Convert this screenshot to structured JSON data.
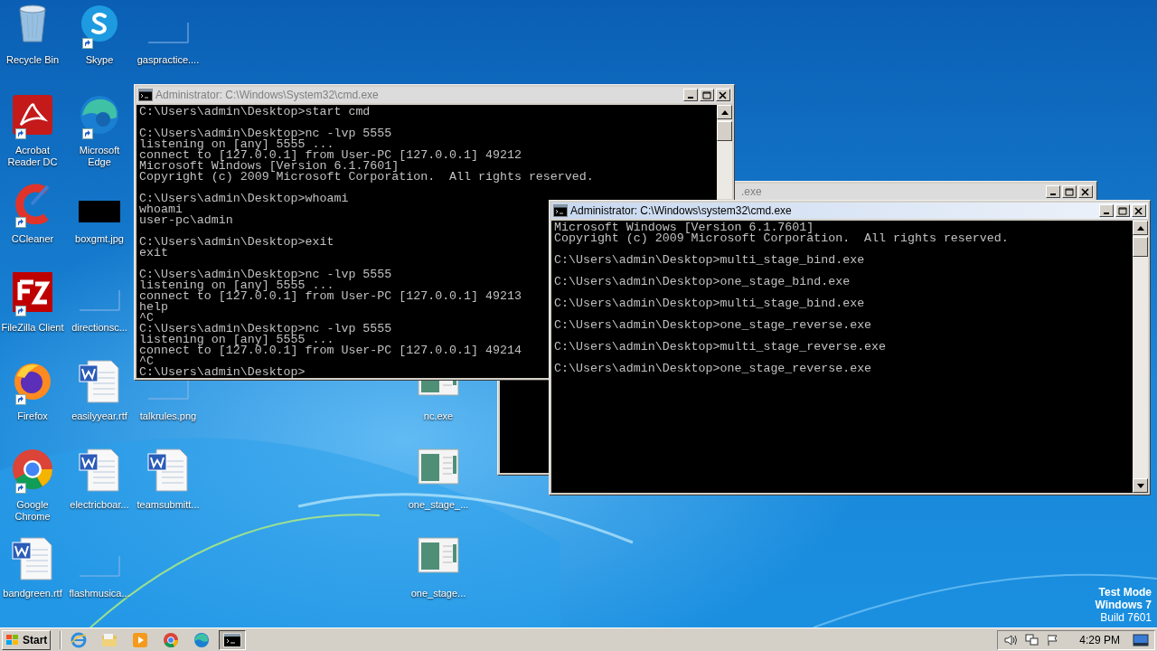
{
  "desktop_icons": [
    {
      "label": "Recycle Bin",
      "kind": "recycle",
      "shortcut": false
    },
    {
      "label": "Acrobat Reader DC",
      "kind": "acrobat",
      "shortcut": true
    },
    {
      "label": "CCleaner",
      "kind": "ccleaner",
      "shortcut": true
    },
    {
      "label": "FileZilla Client",
      "kind": "filezilla",
      "shortcut": true
    },
    {
      "label": "Firefox",
      "kind": "firefox",
      "shortcut": true
    },
    {
      "label": "Google Chrome",
      "kind": "chrome",
      "shortcut": true
    },
    {
      "label": "bandgreen.rtf",
      "kind": "word",
      "shortcut": false
    },
    {
      "label": "Skype",
      "kind": "skype",
      "shortcut": true
    },
    {
      "label": "Microsoft Edge",
      "kind": "edge",
      "shortcut": true
    },
    {
      "label": "boxgmt.jpg",
      "kind": "dark-image",
      "shortcut": false
    },
    {
      "label": "directionsc...",
      "kind": "blank",
      "shortcut": false
    },
    {
      "label": "easilyyear.rtf",
      "kind": "word",
      "shortcut": false
    },
    {
      "label": "electricboar...",
      "kind": "word",
      "shortcut": false
    },
    {
      "label": "flashmusica...",
      "kind": "blank",
      "shortcut": false
    },
    {
      "label": "gaspractice....",
      "kind": "blank",
      "shortcut": false
    },
    {
      "label": "talkrules.png",
      "kind": "blank",
      "shortcut": false
    },
    {
      "label": "teamsubmitt...",
      "kind": "word",
      "shortcut": false
    },
    {
      "label": "nc.exe",
      "kind": "exe",
      "shortcut": false
    },
    {
      "label": "one_stage_...",
      "kind": "exe",
      "shortcut": false
    },
    {
      "label": "one_stage...",
      "kind": "exe",
      "shortcut": false
    }
  ],
  "windows": [
    {
      "title": ".exe",
      "active": false
    },
    {
      "title": "Administrator: C:\\Windows\\System32\\cmd.exe",
      "active": false,
      "blocks": [
        [
          "C:\\Users\\admin\\Desktop>start cmd"
        ],
        [
          "C:\\Users\\admin\\Desktop>nc -lvp 5555",
          "listening on [any] 5555 ...",
          "connect to [127.0.0.1] from User-PC [127.0.0.1] 49212",
          "Microsoft Windows [Version 6.1.7601]",
          "Copyright (c) 2009 Microsoft Corporation.  All rights reserved."
        ],
        [
          "C:\\Users\\admin\\Desktop>whoami",
          "whoami",
          "user-pc\\admin"
        ],
        [
          "C:\\Users\\admin\\Desktop>exit",
          "exit"
        ],
        [
          "C:\\Users\\admin\\Desktop>nc -lvp 5555",
          "listening on [any] 5555 ...",
          "connect to [127.0.0.1] from User-PC [127.0.0.1] 49213",
          "help",
          "^C",
          "C:\\Users\\admin\\Desktop>nc -lvp 5555",
          "listening on [any] 5555 ...",
          "connect to [127.0.0.1] from User-PC [127.0.0.1] 49214",
          "^C",
          "C:\\Users\\admin\\Desktop>"
        ]
      ]
    },
    {
      "title": "Administrator: C:\\Windows\\system32\\cmd.exe",
      "active": true,
      "blocks": [
        [
          "Microsoft Windows [Version 6.1.7601]",
          "Copyright (c) 2009 Microsoft Corporation.  All rights reserved."
        ],
        [
          "C:\\Users\\admin\\Desktop>multi_stage_bind.exe"
        ],
        [
          "C:\\Users\\admin\\Desktop>one_stage_bind.exe"
        ],
        [
          "C:\\Users\\admin\\Desktop>multi_stage_bind.exe"
        ],
        [
          "C:\\Users\\admin\\Desktop>one_stage_reverse.exe"
        ],
        [
          "C:\\Users\\admin\\Desktop>multi_stage_reverse.exe"
        ],
        [
          "C:\\Users\\admin\\Desktop>one_stage_reverse.exe"
        ]
      ]
    }
  ],
  "system_watermark": [
    {
      "text": "Test Mode",
      "bold": true
    },
    {
      "text": "Windows 7",
      "bold": true
    },
    {
      "text": "Build 7601",
      "bold": false
    }
  ],
  "taskbar": {
    "start_label": "Start",
    "apps": [
      {
        "kind": "ie",
        "active": false
      },
      {
        "kind": "explorer",
        "active": false
      },
      {
        "kind": "media",
        "active": false
      },
      {
        "kind": "chrome",
        "active": false
      },
      {
        "kind": "edge",
        "active": false
      },
      {
        "kind": "cmd",
        "active": true
      }
    ],
    "clock": "4:29 PM"
  }
}
